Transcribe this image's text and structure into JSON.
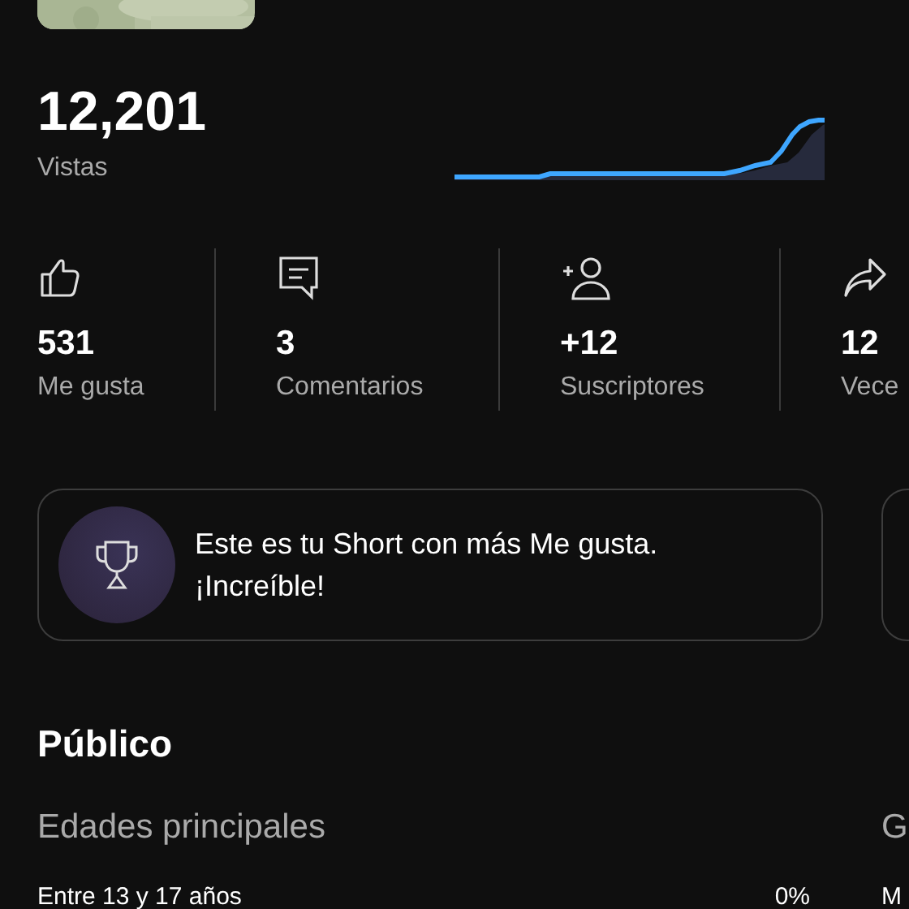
{
  "views": {
    "value": "12,201",
    "label": "Vistas"
  },
  "stats": [
    {
      "kind": "likes",
      "value": "531",
      "label": "Me gusta"
    },
    {
      "kind": "comments",
      "value": "3",
      "label": "Comentarios"
    },
    {
      "kind": "subscribers",
      "value": "+12",
      "label": "Suscriptores"
    },
    {
      "kind": "shares",
      "value": "12",
      "label": "Vece"
    }
  ],
  "highlight_card": {
    "text": "Este es tu Short con más Me gusta. ¡Increíble!"
  },
  "audience": {
    "title": "Público",
    "sections": [
      {
        "title": "Edades principales",
        "rows": [
          {
            "label": "Entre 13 y 17 años",
            "value": "0%"
          }
        ]
      },
      {
        "title": "G",
        "rows": [
          {
            "label": "M"
          }
        ]
      }
    ]
  }
}
